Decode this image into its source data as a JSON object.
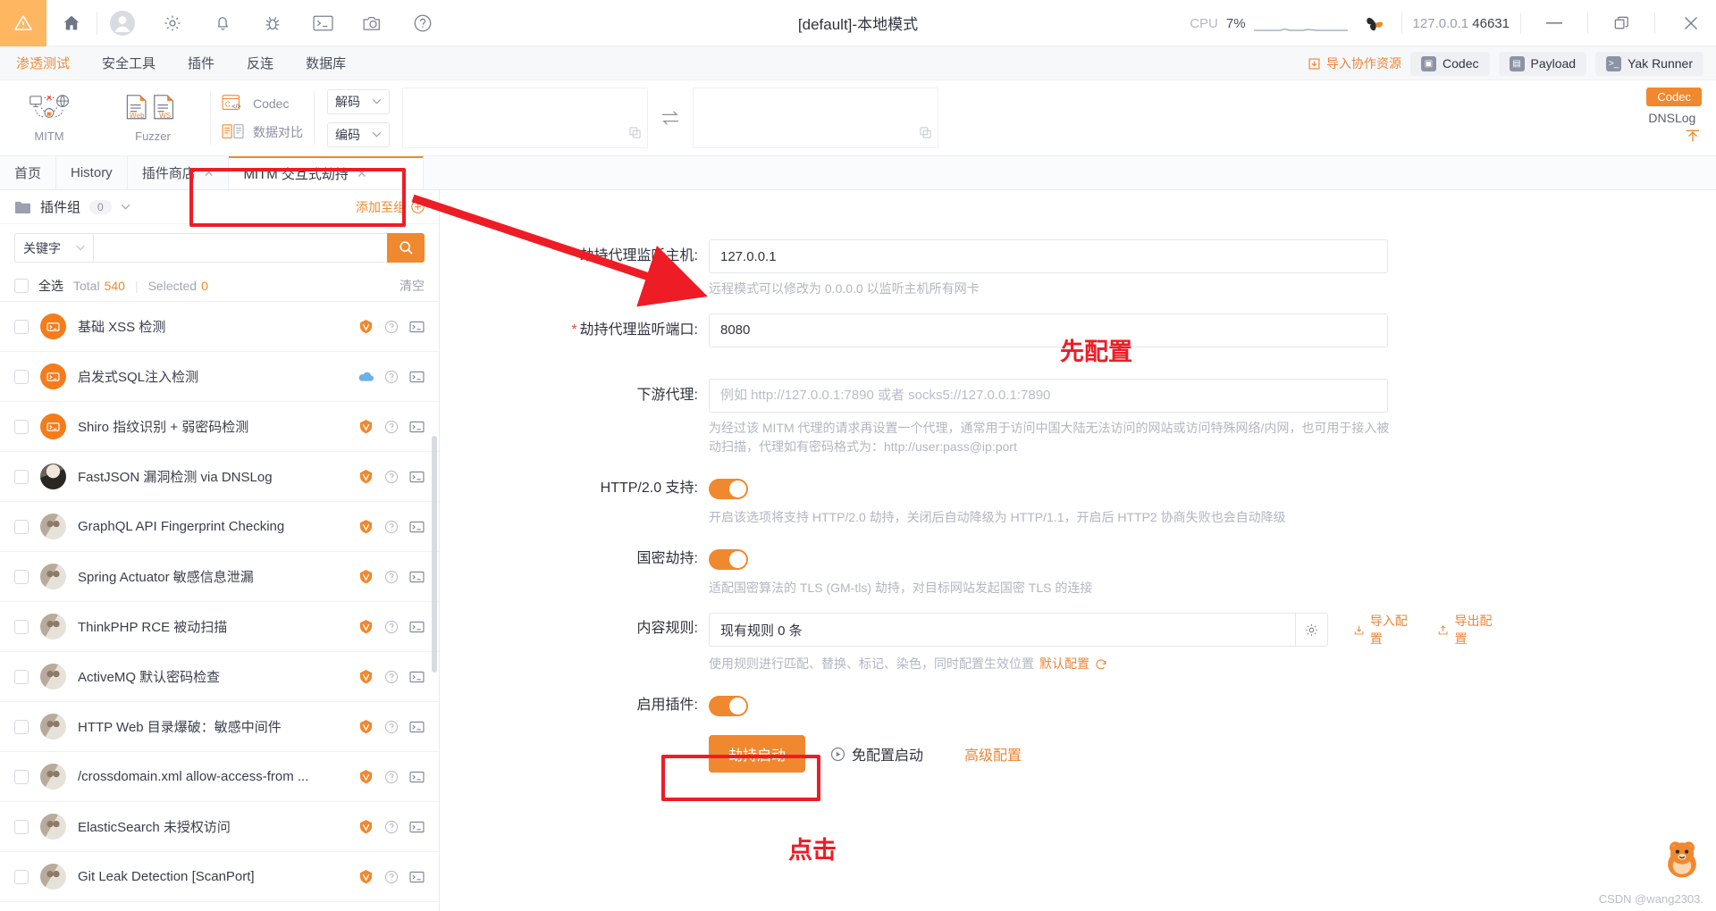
{
  "titlebar": {
    "title": "[default]-本地模式",
    "cpu_label": "CPU",
    "cpu_value": "7%",
    "address_host": "127.0.0.1",
    "address_port": "46631",
    "icons": [
      "warning-icon",
      "home-icon",
      "user-icon",
      "gear-icon",
      "bell-icon",
      "bug-icon",
      "terminal-icon",
      "camera-icon",
      "help-icon"
    ],
    "window_minimize": "—",
    "window_maximize": "❐",
    "window_close": "✕"
  },
  "menubar": {
    "items": [
      {
        "label": "渗透测试",
        "active": true
      },
      {
        "label": "安全工具",
        "active": false
      },
      {
        "label": "插件",
        "active": false
      },
      {
        "label": "反连",
        "active": false
      },
      {
        "label": "数据库",
        "active": false
      }
    ],
    "import_resource": "导入协作资源",
    "quick_buttons": [
      {
        "label": "Codec",
        "icon": "codec-icon"
      },
      {
        "label": "Payload",
        "icon": "payload-icon"
      },
      {
        "label": "Yak Runner",
        "icon": "terminal-icon"
      }
    ]
  },
  "ribbon": {
    "tools": [
      {
        "label": "MITM",
        "icon": "mitm-icon"
      },
      {
        "label": "Fuzzer",
        "icon": "fuzzer-icon"
      }
    ],
    "links": [
      {
        "label": "Codec",
        "icon": "codec-icon"
      },
      {
        "label": "数据对比",
        "icon": "diff-icon"
      }
    ],
    "selects": [
      {
        "label": "解码"
      },
      {
        "label": "编码"
      }
    ],
    "codec_chip": "Codec",
    "dnslog_label": "DNSLog"
  },
  "tabs": [
    {
      "label": "首页",
      "closable": false,
      "active": false
    },
    {
      "label": "History",
      "closable": false,
      "active": false
    },
    {
      "label": "插件商店",
      "closable": true,
      "active": false
    },
    {
      "label": "MITM 交互式劫持",
      "closable": true,
      "active": true
    }
  ],
  "left_panel": {
    "group_title": "插件组",
    "group_count": "0",
    "add_group": "添加至组",
    "search": {
      "select_label": "关键字",
      "value": "",
      "placeholder": ""
    },
    "select_all_label": "全选",
    "total_label": "Total",
    "total_value": "540",
    "selected_label": "Selected",
    "selected_value": "0",
    "clear_label": "清空",
    "plugins": [
      {
        "name": "基础 XSS 检测",
        "avatar": "orange",
        "badge": "shield"
      },
      {
        "name": "启发式SQL注入检测",
        "avatar": "orange",
        "badge": "cloud"
      },
      {
        "name": "Shiro 指纹识别 + 弱密码检测",
        "avatar": "orange",
        "badge": "shield"
      },
      {
        "name": "FastJSON 漏洞检测 via DNSLog",
        "avatar": "dark",
        "badge": "shield"
      },
      {
        "name": "GraphQL API Fingerprint Checking",
        "avatar": "img",
        "badge": "shield"
      },
      {
        "name": "Spring Actuator 敏感信息泄漏",
        "avatar": "img",
        "badge": "shield"
      },
      {
        "name": "ThinkPHP RCE 被动扫描",
        "avatar": "img",
        "badge": "shield"
      },
      {
        "name": "ActiveMQ 默认密码检查",
        "avatar": "img",
        "badge": "shield"
      },
      {
        "name": "HTTP Web 目录爆破：敏感中间件",
        "avatar": "img",
        "badge": "shield"
      },
      {
        "name": "/crossdomain.xml allow-access-from ...",
        "avatar": "img",
        "badge": "shield"
      },
      {
        "name": "ElasticSearch 未授权访问",
        "avatar": "img",
        "badge": "shield"
      },
      {
        "name": "Git Leak Detection [ScanPort]",
        "avatar": "img",
        "badge": "shield"
      }
    ]
  },
  "form": {
    "host": {
      "label": "劫持代理监听主机:",
      "required": true,
      "value": "127.0.0.1",
      "help": "远程模式可以修改为 0.0.0.0 以监听主机所有网卡"
    },
    "port": {
      "label": "劫持代理监听端口:",
      "required": true,
      "value": "8080",
      "help": ""
    },
    "downstream": {
      "label": "下游代理:",
      "required": false,
      "value": "",
      "placeholder": "例如 http://127.0.0.1:7890 或者 socks5://127.0.0.1:7890",
      "help": "为经过该 MITM 代理的请求再设置一个代理，通常用于访问中国大陆无法访问的网站或访问特殊网络/内网，也可用于接入被动扫描，代理如有密码格式为：http://user:pass@ip:port"
    },
    "http2": {
      "label": "HTTP/2.0 支持:",
      "enabled": true,
      "help": "开启该选项将支持 HTTP/2.0 劫持，关闭后自动降级为 HTTP/1.1，开启后 HTTP2 协商失败也会自动降级"
    },
    "gmtls": {
      "label": "国密劫持:",
      "enabled": true,
      "help": "适配国密算法的 TLS (GM-tls) 劫持，对目标网站发起国密 TLS 的连接"
    },
    "rules": {
      "label": "内容规则:",
      "value": "现有规则 0 条",
      "help_prefix": "使用规则进行匹配、替换、标记、染色，同时配置生效位置",
      "help_link": "默认配置",
      "import_label": "导入配置",
      "export_label": "导出配置"
    },
    "plugins_toggle": {
      "label": "启用插件:",
      "enabled": true
    },
    "actions": {
      "start": "劫持启动",
      "no_config_start": "免配置启动",
      "advanced": "高级配置"
    }
  },
  "annotations": {
    "config_first": "先配置",
    "click_here": "点击"
  },
  "watermark": "CSDN @wang2303.",
  "colors": {
    "accent": "#f0882f",
    "annotation_red": "#ee1c25",
    "text_primary": "#31343f",
    "text_muted": "#b2b6c2"
  }
}
